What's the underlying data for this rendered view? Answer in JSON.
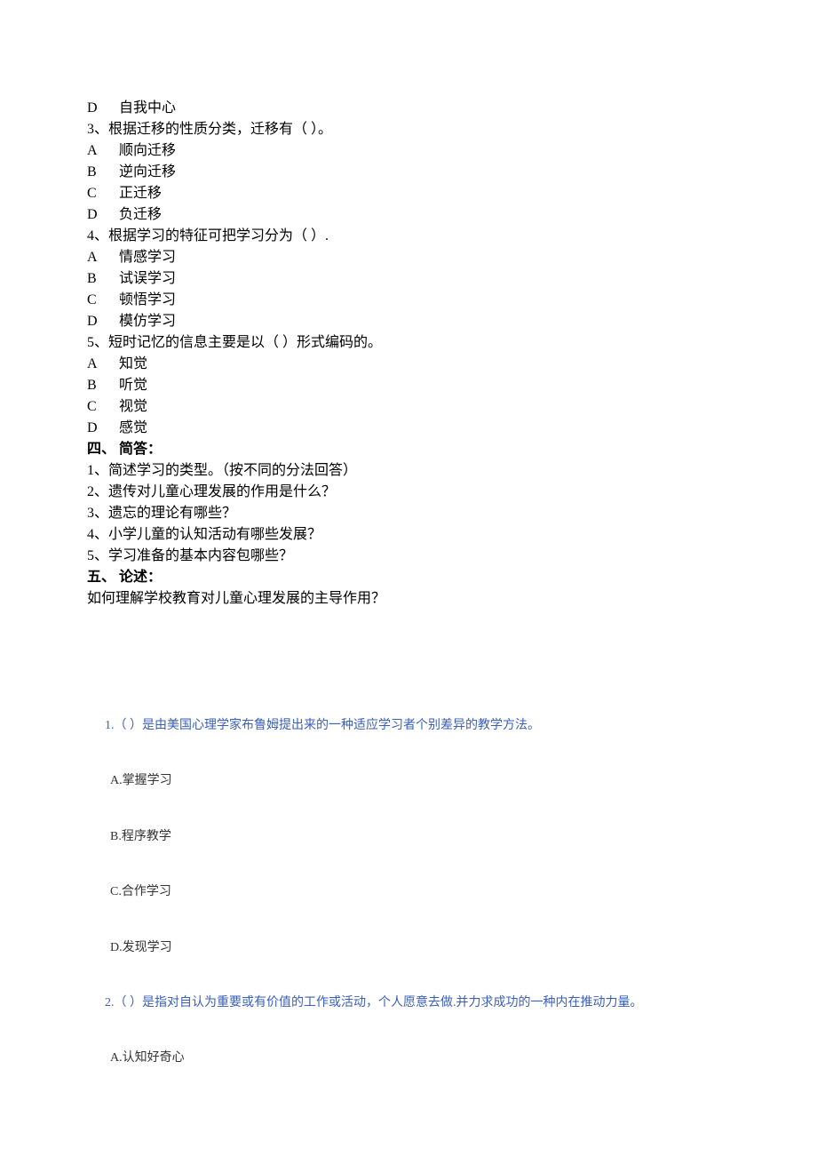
{
  "topBlock": {
    "optionD": {
      "letter": "D",
      "text": "自我中心"
    },
    "q3": {
      "stem": "3、根据迁移的性质分类，迁移有（   ）。",
      "options": [
        {
          "letter": "A",
          "text": "顺向迁移"
        },
        {
          "letter": "B",
          "text": "逆向迁移"
        },
        {
          "letter": "C",
          "text": "正迁移"
        },
        {
          "letter": "D",
          "text": "负迁移"
        }
      ]
    },
    "q4": {
      "stem": "4、根据学习的特征可把学习分为（    ）.",
      "options": [
        {
          "letter": "A",
          "text": "情感学习"
        },
        {
          "letter": "B",
          "text": "试误学习"
        },
        {
          "letter": "C",
          "text": "顿悟学习"
        },
        {
          "letter": "D",
          "text": "模仿学习"
        }
      ]
    },
    "q5": {
      "stem": "5、短时记忆的信息主要是以（    ）形式编码的。",
      "options": [
        {
          "letter": "A",
          "text": "知觉"
        },
        {
          "letter": "B",
          "text": "听觉"
        },
        {
          "letter": "C",
          "text": "视觉"
        },
        {
          "letter": "D",
          "text": "感觉"
        }
      ]
    },
    "section4": {
      "heading": "四、    简答：",
      "items": [
        "1、简述学习的类型。（按不同的分法回答）",
        "2、遗传对儿童心理发展的作用是什么？",
        "3、遗忘的理论有哪些？",
        "4、小学儿童的认知活动有哪些发展？",
        "5、学习准备的基本内容包哪些？"
      ]
    },
    "section5": {
      "heading": "五、    论述：",
      "body": "如何理解学校教育对儿童心理发展的主导作用？"
    }
  },
  "secondaryBlock": {
    "q1": {
      "stem": "1.（      ）是由美国心理学家布鲁姆提出来的一种适应学习者个别差异的教学方法。",
      "options": [
        "A.掌握学习",
        "B.程序教学",
        "C.合作学习",
        "D.发现学习"
      ]
    },
    "q2": {
      "stem": "2.（      ）是指对自认为重要或有价值的工作或活动，个人愿意去做.并力求成功的一种内在推动力量。",
      "optionA": "A.认知好奇心"
    }
  }
}
